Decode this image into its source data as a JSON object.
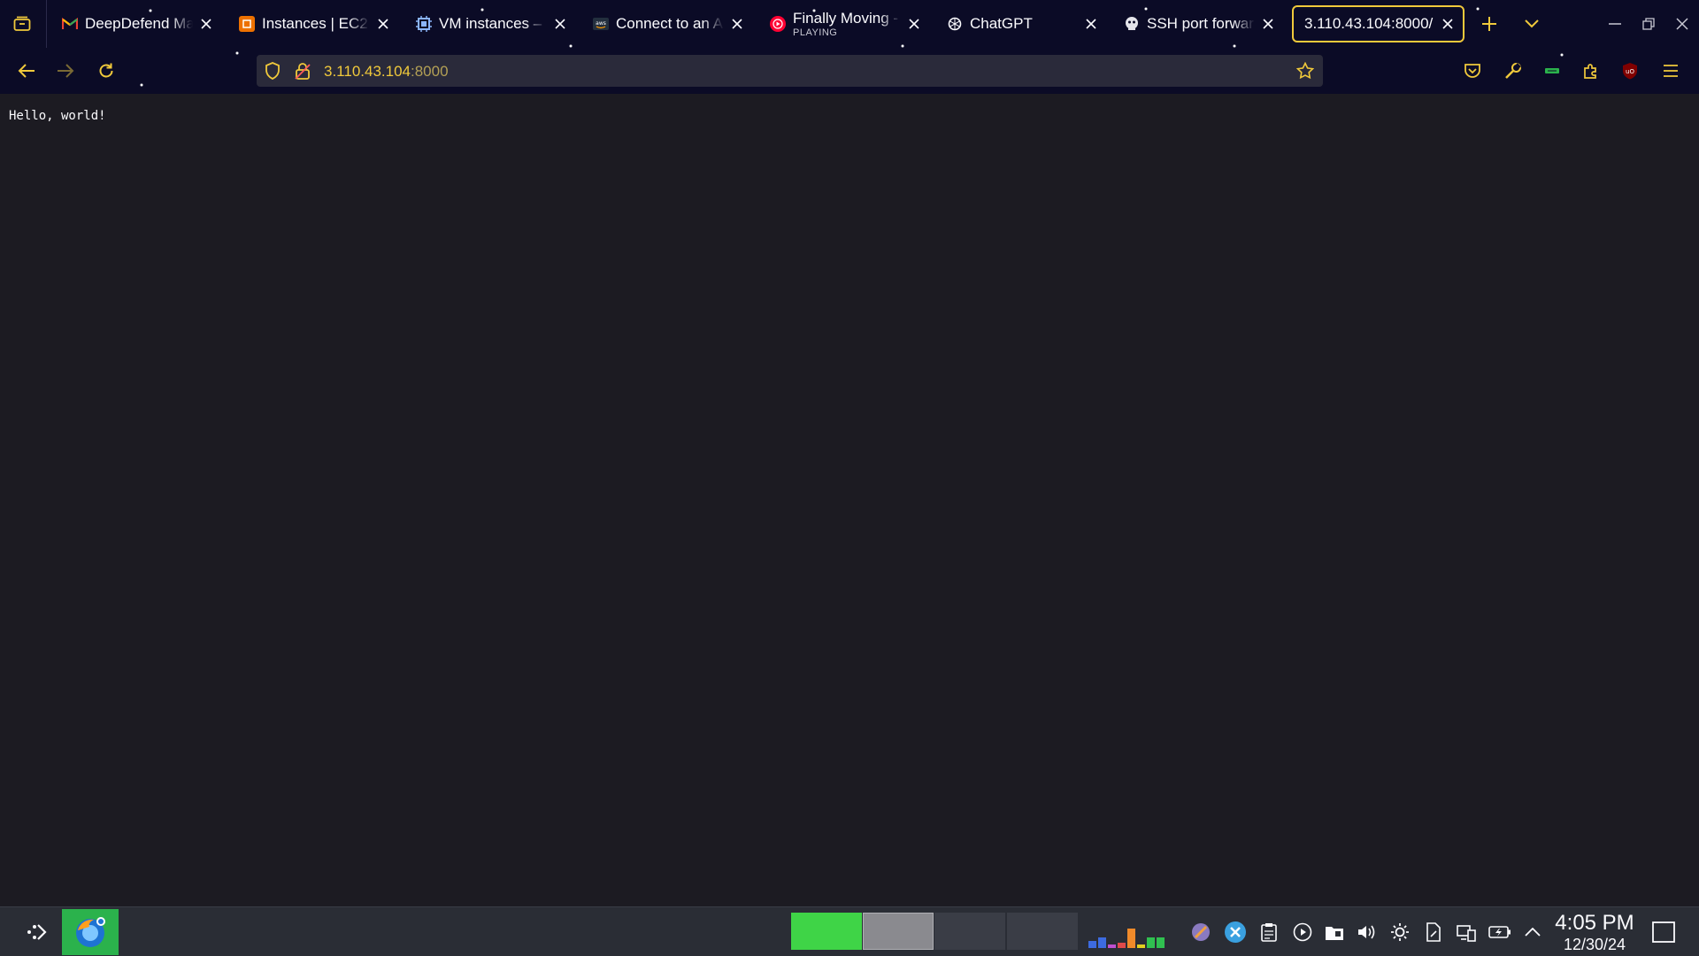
{
  "browser": {
    "tabs": [
      {
        "title": "DeepDefend Ma",
        "favicon": "gmail-icon",
        "subtitle": ""
      },
      {
        "title": "Instances | EC2",
        "favicon": "aws-ec2-icon",
        "subtitle": ""
      },
      {
        "title": "VM instances – C",
        "favicon": "gcp-compute-icon",
        "subtitle": ""
      },
      {
        "title": "Connect to an A",
        "favicon": "aws-icon",
        "subtitle": ""
      },
      {
        "title": "Finally Moving -",
        "favicon": "youtube-music-icon",
        "subtitle": "PLAYING"
      },
      {
        "title": "ChatGPT",
        "favicon": "chatgpt-icon",
        "subtitle": ""
      },
      {
        "title": "SSH port forwar",
        "favicon": "ssh-icon",
        "subtitle": ""
      },
      {
        "title": "3.110.43.104:8000/",
        "favicon": "",
        "subtitle": "",
        "active": true
      }
    ],
    "url": {
      "host": "3.110.43.104",
      "port": ":8000"
    },
    "accent": "#f0c93b"
  },
  "page": {
    "body_text": "Hello, world!"
  },
  "taskbar": {
    "time": "4:05 PM",
    "date": "12/30/24",
    "pager_colors": [
      "#3fd447",
      "#8a8a8f",
      "#3a3d46",
      "#3a3d46"
    ]
  }
}
